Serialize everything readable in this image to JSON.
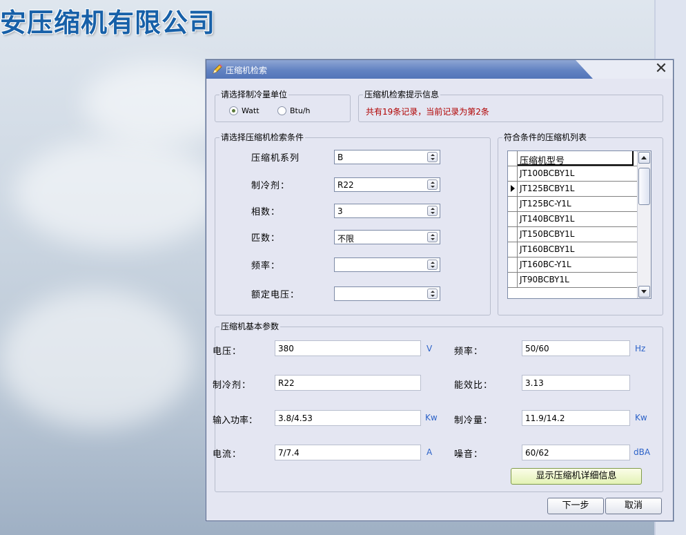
{
  "desktop": {
    "company_name": "安压缩机有限公司"
  },
  "dialog": {
    "title": "压缩机检索",
    "close_glyph": "✕",
    "unit_group": {
      "label": "请选择制冷量单位",
      "options": [
        {
          "label": "Watt",
          "selected": true
        },
        {
          "label": "Btu/h",
          "selected": false
        }
      ]
    },
    "info_group": {
      "label": "压缩机检索提示信息",
      "message": "共有19条记录，当前记录为第2条"
    },
    "criteria": {
      "label": "请选择压缩机检索条件",
      "fields": [
        {
          "label": "压缩机系列",
          "value": "B"
        },
        {
          "label": "制冷剂：",
          "value": "R22"
        },
        {
          "label": "相数：",
          "value": "3"
        },
        {
          "label": "匹数：",
          "value": "不限"
        },
        {
          "label": "频率：",
          "value": ""
        },
        {
          "label": "额定电压：",
          "value": ""
        }
      ]
    },
    "list": {
      "label": "符合条件的压缩机列表",
      "header": "压缩机型号",
      "current_index": 1,
      "rows": [
        "JT100BCBY1L",
        "JT125BCBY1L",
        "JT125BC-Y1L",
        "JT140BCBY1L",
        "JT150BCBY1L",
        "JT160BCBY1L",
        "JT160BC-Y1L",
        "JT90BCBY1L"
      ]
    },
    "params": {
      "label": "压缩机基本参数",
      "voltage": {
        "label": "电压：",
        "value": "380",
        "unit": "V"
      },
      "frequency": {
        "label": "频率：",
        "value": "50/60",
        "unit": "Hz"
      },
      "refrigerant": {
        "label": "制冷剂：",
        "value": "R22"
      },
      "eer": {
        "label": "能效比：",
        "value": "3.13"
      },
      "input_power": {
        "label": "输入功率：",
        "value": "3.8/4.53",
        "unit": "Kw"
      },
      "capacity": {
        "label": "制冷量：",
        "value": "11.9/14.2",
        "unit": "Kw"
      },
      "current": {
        "label": "电流：",
        "value": "7/7.4",
        "unit": "A"
      },
      "noise": {
        "label": "噪音：",
        "value": "60/62",
        "unit": "dBA"
      },
      "detail_button": "显示压缩机详细信息"
    },
    "next_button": "下一步",
    "cancel_button": "取消"
  }
}
